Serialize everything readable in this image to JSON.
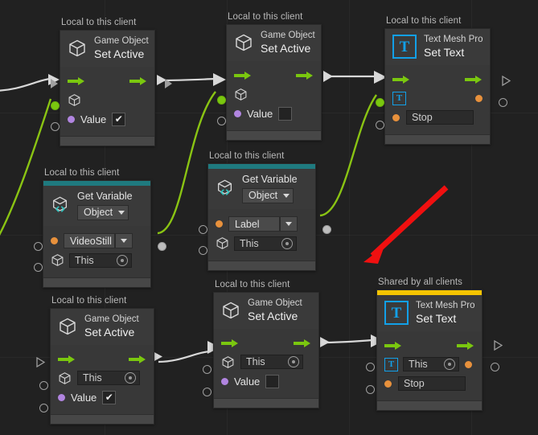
{
  "canvas": {
    "background_color": "#212121",
    "grid_color": "#2a2a2a"
  },
  "colors": {
    "flow_arrow_green": "#7ac70f",
    "object_wire_green": "#8ac413",
    "exec_wire_white": "#d8d8d8",
    "accent_teal": "#1f7a7f",
    "accent_yellow": "#f5c400",
    "tmp_blue": "#12a0e8",
    "port_orange": "#e8913c",
    "port_purple": "#b185e0",
    "annotation_red": "#f01010"
  },
  "group_labels": {
    "local": "Local to this client",
    "shared": "Shared by all clients"
  },
  "nodes": [
    {
      "id": "set-active-1",
      "group_label": "Local to this client",
      "title_small": "Game Object",
      "title_big": "Set Active",
      "icon": "cube-icon",
      "accent": "none",
      "rows": [
        {
          "type": "flow",
          "left_icon": "flow-arrow-in-icon",
          "right_icon": "flow-arrow-out-icon"
        },
        {
          "type": "object",
          "icon": "cube-icon",
          "value": ""
        },
        {
          "type": "value",
          "dot": "purple",
          "label": "Value",
          "checked": true
        }
      ]
    },
    {
      "id": "set-active-2",
      "group_label": "Local to this client",
      "title_small": "Game Object",
      "title_big": "Set Active",
      "icon": "cube-icon",
      "accent": "none",
      "rows": [
        {
          "type": "flow",
          "left_icon": "flow-arrow-in-icon",
          "right_icon": "flow-arrow-out-icon"
        },
        {
          "type": "object",
          "icon": "cube-icon",
          "value": ""
        },
        {
          "type": "value",
          "dot": "purple",
          "label": "Value",
          "checked": false
        }
      ]
    },
    {
      "id": "set-text-1",
      "group_label": "Local to this client",
      "title_small": "Text Mesh Pro",
      "title_big": "Set Text",
      "icon": "tmp-icon",
      "icon_glyph": "T",
      "accent": "none",
      "rows": [
        {
          "type": "flow",
          "left_icon": "flow-arrow-in-icon",
          "right_icon": "flow-arrow-out-icon"
        },
        {
          "type": "tmp-ref",
          "icon": "tmp-icon",
          "icon_glyph": "T",
          "value": ""
        },
        {
          "type": "text",
          "dot": "orange",
          "value": "Stop"
        }
      ]
    },
    {
      "id": "get-variable-1",
      "group_label": "Local to this client",
      "title_small": "Get Variable",
      "title_big": "",
      "icon": "cube-code-icon",
      "accent": "teal",
      "dropdown_type": "Object",
      "rows": [
        {
          "type": "dropdown",
          "dot": "orange",
          "value": "VideoStill"
        },
        {
          "type": "object-field",
          "icon": "cube-icon",
          "value": "This"
        }
      ]
    },
    {
      "id": "get-variable-2",
      "group_label": "Local to this client",
      "title_small": "Get Variable",
      "title_big": "",
      "icon": "cube-code-icon",
      "accent": "teal",
      "dropdown_type": "Object",
      "rows": [
        {
          "type": "dropdown",
          "dot": "orange",
          "value": "Label"
        },
        {
          "type": "object-field",
          "icon": "cube-icon",
          "value": "This"
        }
      ]
    },
    {
      "id": "set-active-3",
      "group_label": "Local to this client",
      "title_small": "Game Object",
      "title_big": "Set Active",
      "icon": "cube-icon",
      "accent": "none",
      "rows": [
        {
          "type": "flow",
          "left_icon": "flow-arrow-in-icon",
          "right_icon": "flow-arrow-out-icon"
        },
        {
          "type": "object-field",
          "icon": "cube-icon",
          "value": "This"
        },
        {
          "type": "value",
          "dot": "purple",
          "label": "Value",
          "checked": true
        }
      ]
    },
    {
      "id": "set-active-4",
      "group_label": "Local to this client",
      "title_small": "Game Object",
      "title_big": "Set Active",
      "icon": "cube-icon",
      "accent": "none",
      "rows": [
        {
          "type": "flow",
          "left_icon": "flow-arrow-in-icon",
          "right_icon": "flow-arrow-out-icon"
        },
        {
          "type": "object-field",
          "icon": "cube-icon",
          "value": "This"
        },
        {
          "type": "value",
          "dot": "purple",
          "label": "Value",
          "checked": false
        }
      ]
    },
    {
      "id": "set-text-2",
      "group_label": "Shared by all clients",
      "title_small": "Text Mesh Pro",
      "title_big": "Set Text",
      "icon": "tmp-icon",
      "icon_glyph": "T",
      "accent": "yellow",
      "rows": [
        {
          "type": "flow",
          "left_icon": "flow-arrow-in-icon",
          "right_icon": "flow-arrow-out-icon"
        },
        {
          "type": "tmp-ref",
          "icon": "tmp-icon",
          "icon_glyph": "T",
          "value": "This"
        },
        {
          "type": "text",
          "dot": "orange",
          "value": "Stop"
        }
      ]
    }
  ],
  "n1": {
    "group": "Local to this client",
    "small": "Game Object",
    "big": "Set Active",
    "value_label": "Value",
    "check": "✔"
  },
  "n2": {
    "group": "Local to this client",
    "small": "Game Object",
    "big": "Set Active",
    "value_label": "Value"
  },
  "n3": {
    "group": "Local to this client",
    "small": "Text Mesh Pro",
    "big": "Set Text",
    "glyph": "T",
    "text_value": "Stop"
  },
  "n4": {
    "group": "Local to this client",
    "small": "Get Variable",
    "type_value": "Object",
    "var_value": "VideoStill",
    "obj_value": "This"
  },
  "n5": {
    "group": "Local to this client",
    "small": "Get Variable",
    "type_value": "Object",
    "var_value": "Label",
    "obj_value": "This"
  },
  "n6": {
    "group": "Local to this client",
    "small": "Game Object",
    "big": "Set Active",
    "obj_value": "This",
    "value_label": "Value",
    "check": "✔"
  },
  "n7": {
    "group": "Local to this client",
    "small": "Game Object",
    "big": "Set Active",
    "obj_value": "This",
    "value_label": "Value"
  },
  "n8": {
    "group": "Shared by all clients",
    "small": "Text Mesh Pro",
    "big": "Set Text",
    "glyph": "T",
    "obj_value": "This",
    "text_value": "Stop"
  }
}
